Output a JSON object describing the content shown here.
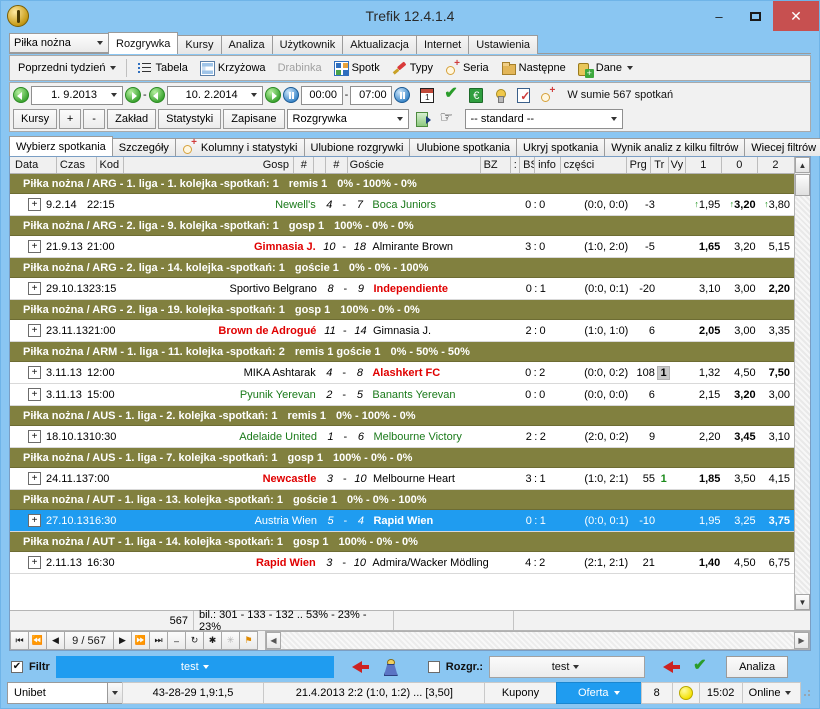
{
  "window": {
    "title": "Trefik 12.4.1.4",
    "minimize": "–",
    "maximize": "❐",
    "close": "✕"
  },
  "menu": {
    "sport_select": "Piłka nożna",
    "tabs": [
      {
        "label": "Rozgrywka",
        "active": true
      },
      {
        "label": "Kursy",
        "active": false
      },
      {
        "label": "Analiza",
        "active": false
      },
      {
        "label": "Użytkownik",
        "active": false
      },
      {
        "label": "Aktualizacja",
        "active": false
      },
      {
        "label": "Internet",
        "active": false
      },
      {
        "label": "Ustawienia",
        "active": false
      }
    ]
  },
  "toolbar": {
    "prev_week": "Poprzedni tydzień",
    "tabela": "Tabela",
    "krzyzowa": "Krzyżowa",
    "drabinka": "Drabinka",
    "spotk": "Spotk",
    "typy": "Typy",
    "seria": "Seria",
    "nastepne": "Następne",
    "dane": "Dane"
  },
  "daterow": {
    "date_from": "1.  9.2013",
    "date_to": "10.  2.2014",
    "separator": "-",
    "time_from": "00:00",
    "time_sep": "-",
    "time_to": "07:00",
    "summary": "W sumie 567 spotkań"
  },
  "optionsrow": {
    "kursy": "Kursy",
    "plus": "+",
    "minus": "-",
    "zaklad": "Zakład",
    "statystyki": "Statystyki",
    "zapisane": "Zapisane",
    "mode_select": "Rozgrywka",
    "standard_select": "-- standard --"
  },
  "subtabs": [
    {
      "label": "Wybierz spotkania",
      "active": true,
      "icon": ""
    },
    {
      "label": "Szczegóły",
      "active": false,
      "icon": ""
    },
    {
      "label": "Kolumny i statystyki",
      "active": false,
      "icon": "magnifier-icon"
    },
    {
      "label": "Ulubione rozgrywki",
      "active": false,
      "icon": ""
    },
    {
      "label": "Ulubione spotkania",
      "active": false,
      "icon": ""
    },
    {
      "label": "Ukryj spotkania",
      "active": false,
      "icon": ""
    },
    {
      "label": "Wynik analiz z kilku filtrów",
      "active": false,
      "icon": ""
    },
    {
      "label": "Wiecej filtrów",
      "active": false,
      "icon": ""
    }
  ],
  "grid": {
    "columns": [
      {
        "key": "data",
        "label": "Data"
      },
      {
        "key": "czas",
        "label": "Czas"
      },
      {
        "key": "kod",
        "label": "Kod"
      },
      {
        "key": "gosp",
        "label": "Gosp"
      },
      {
        "key": "n1",
        "label": "#"
      },
      {
        "key": "dash",
        "label": ""
      },
      {
        "key": "n2",
        "label": "#"
      },
      {
        "key": "gosc",
        "label": "Goście"
      },
      {
        "key": "bz",
        "label": "BZ"
      },
      {
        "key": "colon",
        "label": ":"
      },
      {
        "key": "bs",
        "label": "BS"
      },
      {
        "key": "info",
        "label": "info"
      },
      {
        "key": "czesci",
        "label": "części"
      },
      {
        "key": "prg",
        "label": "Prg"
      },
      {
        "key": "tr",
        "label": "Tr"
      },
      {
        "key": "vy",
        "label": "Vy"
      },
      {
        "key": "o1",
        "label": "1"
      },
      {
        "key": "o0",
        "label": "0"
      },
      {
        "key": "o2",
        "label": "2"
      }
    ],
    "rows": [
      {
        "type": "group",
        "title": "Piłka nożna / ARG - 1. liga - 1. kolejka -spotkań: 1",
        "result": "remis 1",
        "pct": "0% - 100% - 0%"
      },
      {
        "type": "match",
        "expander": "+",
        "data": "9.2.14",
        "czas": "22:15",
        "kod": "",
        "gosp": "Newell's",
        "gosp_style": "green",
        "n1": "4",
        "dash": "-",
        "n2": "7",
        "gosc": "Boca Juniors",
        "gosc_style": "green",
        "bz": "0",
        "colon": ":",
        "bs": "0",
        "info": "",
        "czesci": "(0:0, 0:0)",
        "prg": "-3",
        "tr": "",
        "vy": "",
        "o1": "1,95",
        "o1_arrow": true,
        "o0": "3,20",
        "o0_arrow": true,
        "o0_bold": true,
        "o2": "3,80",
        "o2_arrow": true,
        "selected": false
      },
      {
        "type": "group",
        "title": "Piłka nożna / ARG - 2. liga - 9. kolejka -spotkań: 1",
        "result": "gosp 1",
        "pct": "100% - 0% - 0%"
      },
      {
        "type": "match",
        "expander": "+",
        "data": "21.9.13",
        "czas": "21:00",
        "kod": "",
        "gosp": "Gimnasia J.",
        "gosp_style": "red",
        "n1": "10",
        "dash": "-",
        "n2": "18",
        "gosc": "Almirante Brown",
        "gosc_style": "",
        "bz": "3",
        "colon": ":",
        "bs": "0",
        "info": "",
        "czesci": "(1:0, 2:0)",
        "prg": "-5",
        "tr": "",
        "vy": "",
        "o1": "1,65",
        "o1_bold": true,
        "o0": "3,20",
        "o2": "5,15",
        "selected": false
      },
      {
        "type": "group",
        "title": "Piłka nożna / ARG - 2. liga - 14. kolejka -spotkań: 1",
        "result": "goście 1",
        "pct": "0% - 0% - 100%"
      },
      {
        "type": "match",
        "expander": "+",
        "data": "29.10.13",
        "czas": "23:15",
        "kod": "",
        "gosp": "Sportivo Belgrano",
        "gosp_style": "",
        "n1": "8",
        "dash": "-",
        "n2": "9",
        "gosc": "Independiente",
        "gosc_style": "red",
        "bz": "0",
        "colon": ":",
        "bs": "1",
        "info": "",
        "czesci": "(0:0, 0:1)",
        "prg": "-20",
        "tr": "",
        "vy": "",
        "o1": "3,10",
        "o0": "3,00",
        "o2": "2,20",
        "o2_bold": true,
        "selected": false
      },
      {
        "type": "group",
        "title": "Piłka nożna / ARG - 2. liga - 19. kolejka -spotkań: 1",
        "result": "gosp 1",
        "pct": "100% - 0% - 0%"
      },
      {
        "type": "match",
        "expander": "+",
        "data": "23.11.13",
        "czas": "21:00",
        "kod": "",
        "gosp": "Brown de Adrogué",
        "gosp_style": "red",
        "n1": "11",
        "dash": "-",
        "n2": "14",
        "gosc": "Gimnasia J.",
        "gosc_style": "",
        "bz": "2",
        "colon": ":",
        "bs": "0",
        "info": "",
        "czesci": "(1:0, 1:0)",
        "prg": "6",
        "tr": "",
        "vy": "",
        "o1": "2,05",
        "o1_bold": true,
        "o0": "3,00",
        "o2": "3,35",
        "selected": false
      },
      {
        "type": "group",
        "title": "Piłka nożna / ARM - 1. liga - 11. kolejka -spotkań: 2",
        "result": "remis 1  goście 1",
        "pct": "0% - 50% - 50%"
      },
      {
        "type": "match",
        "expander": "+",
        "data": "3.11.13",
        "czas": "12:00",
        "kod": "",
        "gosp": "MIKA Ashtarak",
        "gosp_style": "",
        "n1": "4",
        "dash": "-",
        "n2": "8",
        "gosc": "Alashkert FC",
        "gosc_style": "red",
        "bz": "0",
        "colon": ":",
        "bs": "2",
        "info": "",
        "czesci": "(0:0, 0:2)",
        "prg": "108",
        "tr": "1",
        "tr_box": true,
        "vy": "",
        "o1": "1,32",
        "o0": "4,50",
        "o2": "7,50",
        "o2_bold": true,
        "selected": false
      },
      {
        "type": "match",
        "expander": "+",
        "data": "3.11.13",
        "czas": "15:00",
        "kod": "",
        "gosp": "Pyunik Yerevan",
        "gosp_style": "green",
        "n1": "2",
        "dash": "-",
        "n2": "5",
        "gosc": "Banants Yerevan",
        "gosc_style": "green",
        "bz": "0",
        "colon": ":",
        "bs": "0",
        "info": "",
        "czesci": "(0:0, 0:0)",
        "prg": "6",
        "tr": "",
        "vy": "",
        "o1": "2,15",
        "o0": "3,20",
        "o0_bold": true,
        "o2": "3,00",
        "selected": false
      },
      {
        "type": "group",
        "title": "Piłka nożna / AUS - 1. liga - 2. kolejka -spotkań: 1",
        "result": "remis 1",
        "pct": "0% - 100% - 0%"
      },
      {
        "type": "match",
        "expander": "+",
        "data": "18.10.13",
        "czas": "10:30",
        "kod": "",
        "gosp": "Adelaide United",
        "gosp_style": "green",
        "n1": "1",
        "dash": "-",
        "n2": "6",
        "gosc": "Melbourne Victory",
        "gosc_style": "green",
        "bz": "2",
        "colon": ":",
        "bs": "2",
        "info": "",
        "czesci": "(2:0, 0:2)",
        "prg": "9",
        "tr": "",
        "vy": "",
        "o1": "2,20",
        "o0": "3,45",
        "o0_bold": true,
        "o2": "3,10",
        "selected": false
      },
      {
        "type": "group",
        "title": "Piłka nożna / AUS - 1. liga - 7. kolejka -spotkań: 1",
        "result": "gosp 1",
        "pct": "100% - 0% - 0%"
      },
      {
        "type": "match",
        "expander": "+",
        "data": "24.11.13",
        "czas": "7:00",
        "kod": "",
        "gosp": "Newcastle",
        "gosp_style": "red",
        "n1": "3",
        "dash": "-",
        "n2": "10",
        "gosc": "Melbourne Heart",
        "gosc_style": "",
        "bz": "3",
        "colon": ":",
        "bs": "1",
        "info": "",
        "czesci": "(1:0, 2:1)",
        "prg": "55",
        "tr": "1",
        "tr_green": true,
        "vy": "",
        "o1": "1,85",
        "o1_bold": true,
        "o0": "3,50",
        "o2": "4,15",
        "selected": false
      },
      {
        "type": "group",
        "title": "Piłka nożna / AUT - 1. liga - 13. kolejka -spotkań: 1",
        "result": "goście 1",
        "pct": "0% - 0% - 100%"
      },
      {
        "type": "match",
        "expander": "+",
        "data": "27.10.13",
        "czas": "16:30",
        "kod": "",
        "gosp": "Austria Wien",
        "gosp_style": "",
        "n1": "5",
        "dash": "-",
        "n2": "4",
        "gosc": "Rapid Wien",
        "gosc_style": "bold",
        "bz": "0",
        "colon": ":",
        "bs": "1",
        "info": "",
        "czesci": "(0:0, 0:1)",
        "prg": "-10",
        "tr": "",
        "vy": "",
        "o1": "1,95",
        "o0": "3,25",
        "o2": "3,75",
        "o2_bold": true,
        "selected": true
      },
      {
        "type": "group",
        "title": "Piłka nożna / AUT - 1. liga - 14. kolejka -spotkań: 1",
        "result": "gosp 1",
        "pct": "100% - 0% - 0%"
      },
      {
        "type": "match",
        "expander": "+",
        "data": "2.11.13",
        "czas": "16:30",
        "kod": "",
        "gosp": "Rapid Wien",
        "gosp_style": "red",
        "n1": "3",
        "dash": "-",
        "n2": "10",
        "gosc": "Admira/Wacker Mödling",
        "gosc_style": "",
        "bz": "4",
        "colon": ":",
        "bs": "2",
        "info": "",
        "czesci": "(2:1, 2:1)",
        "prg": "21",
        "tr": "",
        "vy": "",
        "o1": "1,40",
        "o1_bold": true,
        "o0": "4,50",
        "o2": "6,75",
        "selected": false
      }
    ]
  },
  "summary": {
    "count": "567",
    "balance": "bil.: 301 - 133 - 132 .. 53% - 23% - 23%",
    "empty": ""
  },
  "navigator": {
    "first": "⏮",
    "prev_page": "⏪",
    "prev": "◀",
    "position": "9 / 567",
    "next": "▶",
    "next_page": "⏩",
    "last": "⏭",
    "delete": "–",
    "refresh": "↻",
    "star": "✱",
    "star2": "✳",
    "filter": "⚑"
  },
  "filterbar": {
    "filtr_label": "Filtr",
    "filtr_checked": "✔",
    "filter_value": "test",
    "rozgr_label": "Rozgr.:",
    "rozgr_checked": "",
    "rozgr_value": "test",
    "analiza": "Analiza"
  },
  "statusbar": {
    "bookmaker": "Unibet",
    "record": "43-28-29  1,9:1,5",
    "last_match": "21.4.2013 2:2 (1:0, 1:2) ... [3,50]",
    "kupony": "Kupony",
    "oferta": "Oferta",
    "number": "8",
    "time": "15:02",
    "online": "Online"
  },
  "colors": {
    "title_bg": "#8ac6f2",
    "group_bg": "#81803f",
    "selection": "#1f9cf0",
    "close_btn": "#c75050",
    "red_team": "#e00000",
    "green_team": "#1a7a1a"
  }
}
